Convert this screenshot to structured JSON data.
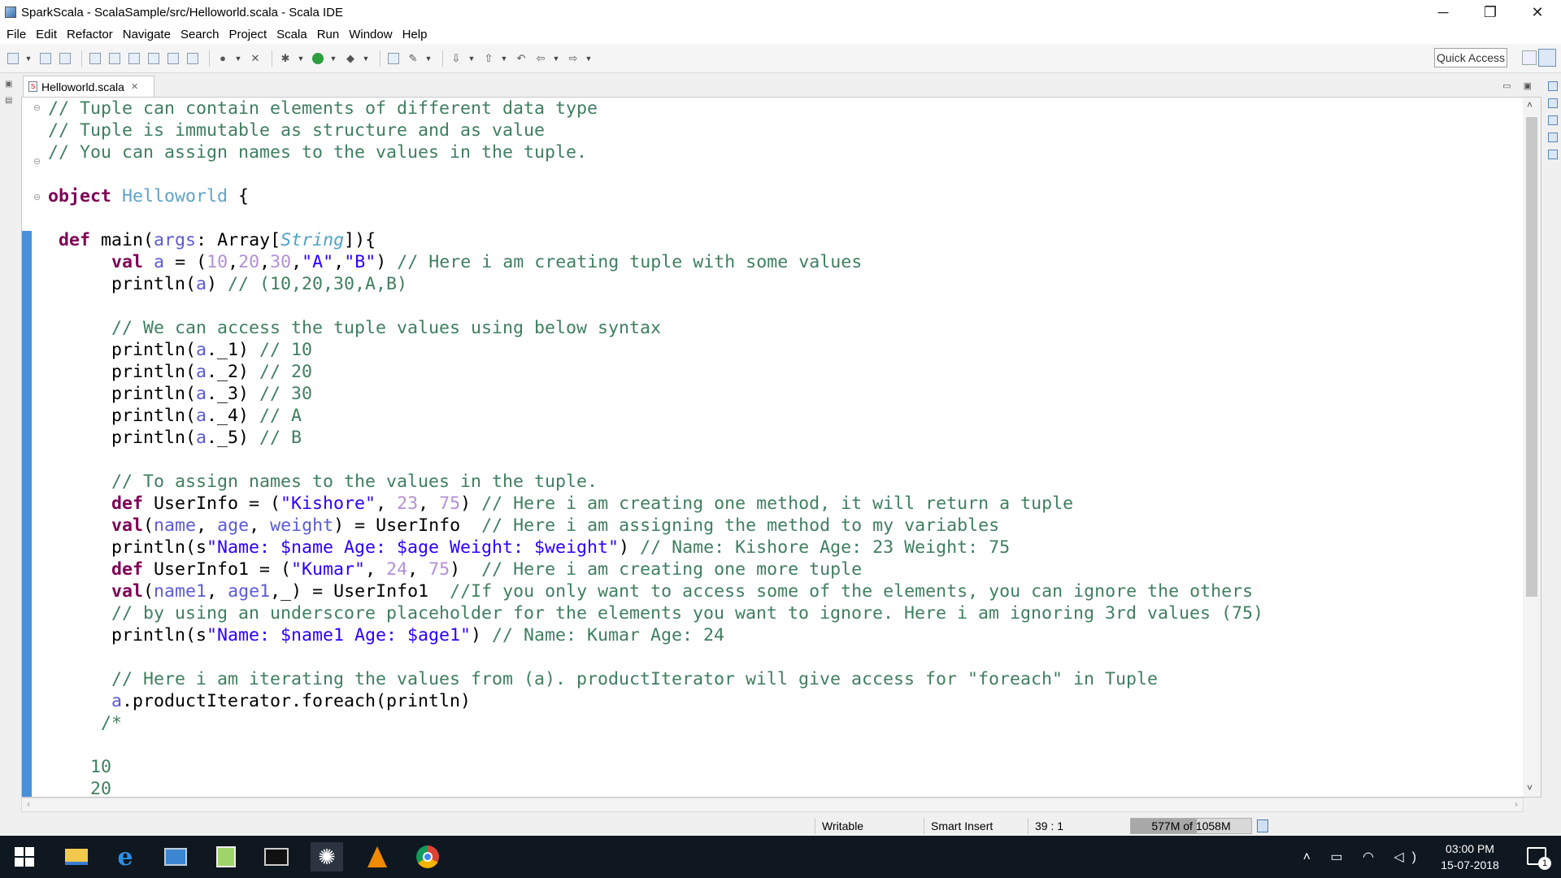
{
  "window": {
    "title": "SparkScala - ScalaSample/src/Helloworld.scala - Scala IDE",
    "minimize": "─",
    "restore": "❐",
    "close": "✕"
  },
  "menu": [
    "File",
    "Edit",
    "Refactor",
    "Navigate",
    "Search",
    "Project",
    "Scala",
    "Run",
    "Window",
    "Help"
  ],
  "toolbar": {
    "quick_access": "Quick Access"
  },
  "editor": {
    "tab_label": "Helloworld.scala",
    "tab_close": "✕",
    "lines": [
      "// Tuple can contain elements of different data type",
      "// Tuple is immutable as structure and as value",
      "// You can assign names to the values in the tuple.",
      "",
      "object Helloworld {",
      "",
      " def main(args: Array[String]){",
      "      val a = (10,20,30,\"A\",\"B\") // Here i am creating tuple with some values",
      "      println(a) // (10,20,30,A,B)",
      "",
      "      // We can access the tuple values using below syntax",
      "      println(a._1) // 10",
      "      println(a._2) // 20",
      "      println(a._3) // 30",
      "      println(a._4) // A",
      "      println(a._5) // B",
      "",
      "      // To assign names to the values in the tuple.",
      "      def UserInfo = (\"Kishore\", 23, 75) // Here i am creating one method, it will return a tuple",
      "      val(name, age, weight) = UserInfo  // Here i am assigning the method to my variables",
      "      println(s\"Name: $name Age: $age Weight: $weight\") // Name: Kishore Age: 23 Weight: 75",
      "      def UserInfo1 = (\"Kumar\", 24, 75)  // Here i am creating one more tuple",
      "      val(name1, age1,_) = UserInfo1  //If you only want to access some of the elements, you can ignore the others",
      "      // by using an underscore placeholder for the elements you want to ignore. Here i am ignoring 3rd values (75)",
      "      println(s\"Name: $name1 Age: $age1\") // Name: Kumar Age: 24",
      "",
      "      // Here i am iterating the values from (a). productIterator will give access for \"foreach\" in Tuple",
      "      a.productIterator.foreach(println)",
      "     /*",
      "",
      "    10",
      "    20"
    ]
  },
  "status": {
    "writable": "Writable",
    "insert_mode": "Smart Insert",
    "position": "39 : 1",
    "heap": "577M of 1058M",
    "heap_fraction": 0.545
  },
  "taskbar": {
    "time": "03:00 PM",
    "date": "15-07-2018",
    "notifications": "1"
  },
  "colors": {
    "comment": "#3f7f5f",
    "keyword": "#7f0055",
    "string": "#2a00ff",
    "number": "#b48fd6",
    "variable": "#5b5bd6",
    "object_name": "#5fa3c7",
    "gutter_change": "#4a90d9"
  }
}
